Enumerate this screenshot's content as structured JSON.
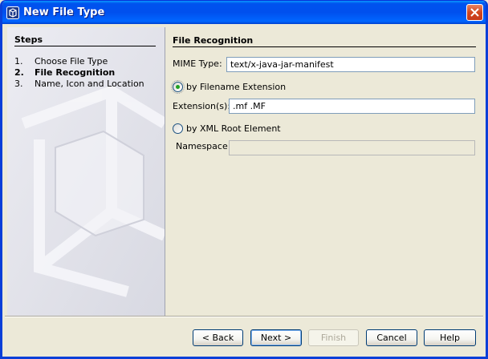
{
  "window": {
    "title": "New File Type"
  },
  "steps": {
    "title": "Steps",
    "items": [
      {
        "num": "1.",
        "label": "Choose File Type"
      },
      {
        "num": "2.",
        "label": "File Recognition"
      },
      {
        "num": "3.",
        "label": "Name, Icon and Location"
      }
    ],
    "active_index": 1
  },
  "content": {
    "title": "File Recognition",
    "mime_label": "MIME Type:",
    "mime_value": "text/x-java-jar-manifest",
    "radio_ext_label": "by Filename Extension",
    "ext_label": "Extension(s):",
    "ext_value": ".mf .MF",
    "radio_xml_label": "by XML Root Element",
    "namespace_label": "Namespace:",
    "namespace_value": "",
    "selected_option": "by Filename Extension"
  },
  "buttons": {
    "back": "< Back",
    "next": "Next >",
    "finish": "Finish",
    "cancel": "Cancel",
    "help": "Help"
  },
  "colors": {
    "titlebar": "#0053EE",
    "window_bg": "#ECE9D8",
    "close_button": "#D2471F"
  }
}
